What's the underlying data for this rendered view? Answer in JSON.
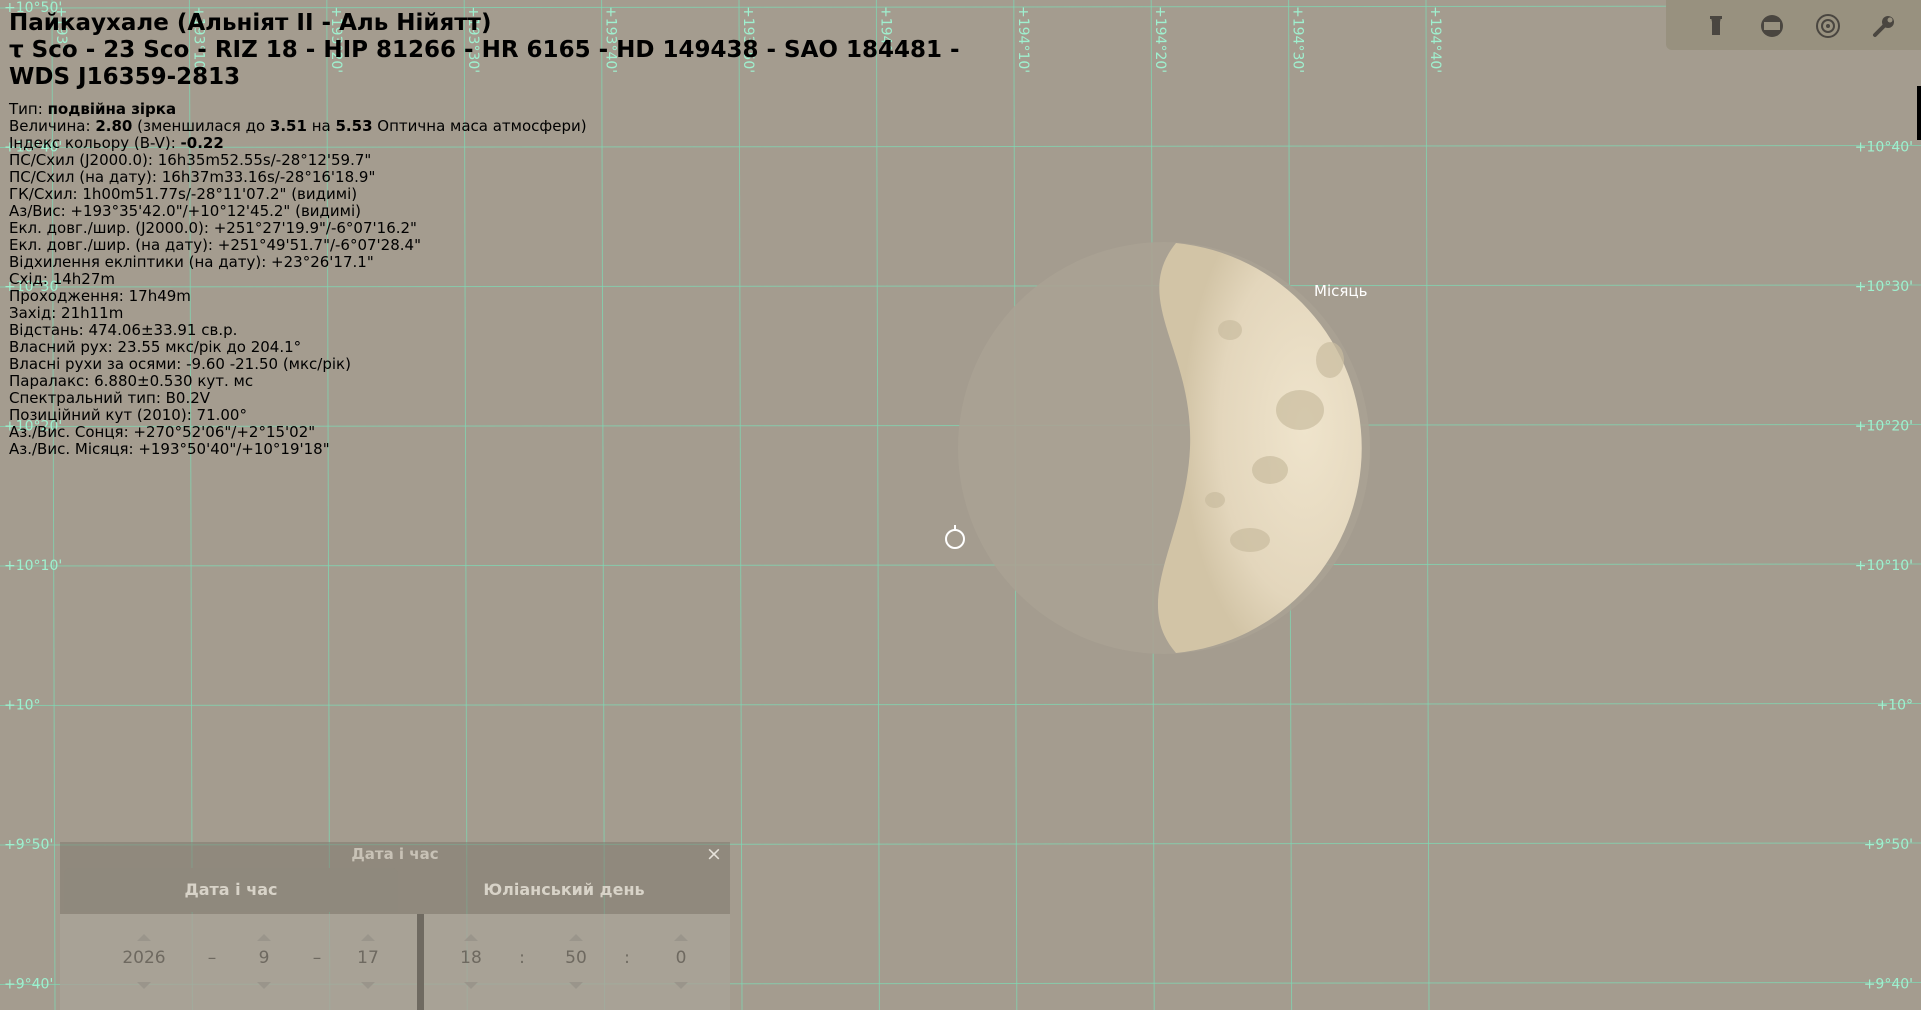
{
  "object": {
    "title_line1": "Пайкаухале (Альніят II - Аль Нійятт)",
    "title_line2": "τ Sco - 23 Sco - RIZ 18 - HIP 81266 - HR 6165 - HD 149438 - SAO 184481 -",
    "title_line3": "WDS J16359-2813",
    "type_label": "Тип:",
    "type_value": "подвійна зірка",
    "mag_label": "Величина:",
    "mag_value": "2.80",
    "mag_text1": "(зменшилася до",
    "mag_ext": "3.51",
    "mag_text2": "на",
    "mag_air": "5.53",
    "mag_text3": "Оптична маса атмосфери)",
    "color_label": "Індекс кольору (B-V):",
    "color_value": "-0.22",
    "lines": [
      "ПС/Схил (J2000.0): 16h35m52.55s/-28°12'59.7\"",
      "ПС/Схил (на дату): 16h37m33.16s/-28°16'18.9\"",
      "ГК/Схил: 1h00m51.77s/-28°11'07.2\" (видимі)",
      "Аз/Вис: +193°35'42.0\"/+10°12'45.2\" (видимі)",
      "Екл. довг./шир. (J2000.0): +251°27'19.9\"/-6°07'16.2\"",
      "Екл. довг./шир. (на дату): +251°49'51.7\"/-6°07'28.4\"",
      "Відхилення екліптики (на дату): +23°26'17.1\"",
      "Схід: 14h27m",
      "Проходження: 17h49m",
      "Захід: 21h11m",
      "Відстань: 474.06±33.91 св.р.",
      "Власний рух: 23.55 мкс/рік до 204.1°",
      "Власні рухи за осями: -9.60 -21.50 (мкс/рік)",
      "Паралакс: 6.880±0.530 кут. мс",
      "Спектральний тип: B0.2V",
      "Позиційний кут (2010): 71.00°",
      "Аз./Вис. Сонця: +270°52'06\"/+2°15'02\"",
      "Аз./Вис. Місяця: +193°50'40\"/+10°19'18\""
    ]
  },
  "moon_label": "Місяць",
  "grid": {
    "az_labels": [
      "+193°",
      "+193°10'",
      "+193°20'",
      "+193°30'",
      "+193°40'",
      "+193°50'",
      "+194°",
      "+194°10'",
      "+194°20'",
      "+194°30'",
      "+194°40'"
    ],
    "alt_labels": [
      "+10°50'",
      "+10°40'",
      "+10°30'",
      "+10°20'",
      "+10°10'",
      "+10°",
      "+9°50'",
      "+9°40'"
    ]
  },
  "toolbar": {
    "icons": [
      "eyepiece-icon",
      "sensor-frame-icon",
      "telrad-icon",
      "wrench-icon"
    ]
  },
  "dialog": {
    "title": "Дата і час",
    "close": "×",
    "tab_datetime": "Дата і час",
    "tab_julian": "Юліанський день",
    "year": "2026",
    "month": "9",
    "day": "17",
    "hour": "18",
    "minute": "50",
    "second": "0",
    "date_sep": "–",
    "time_sep": ":"
  },
  "colors": {
    "sky": "#a49c8f",
    "grid": "#7fd8b4",
    "grid_label": "#9ff0cf",
    "moon_lit": "#e8dcc3"
  }
}
